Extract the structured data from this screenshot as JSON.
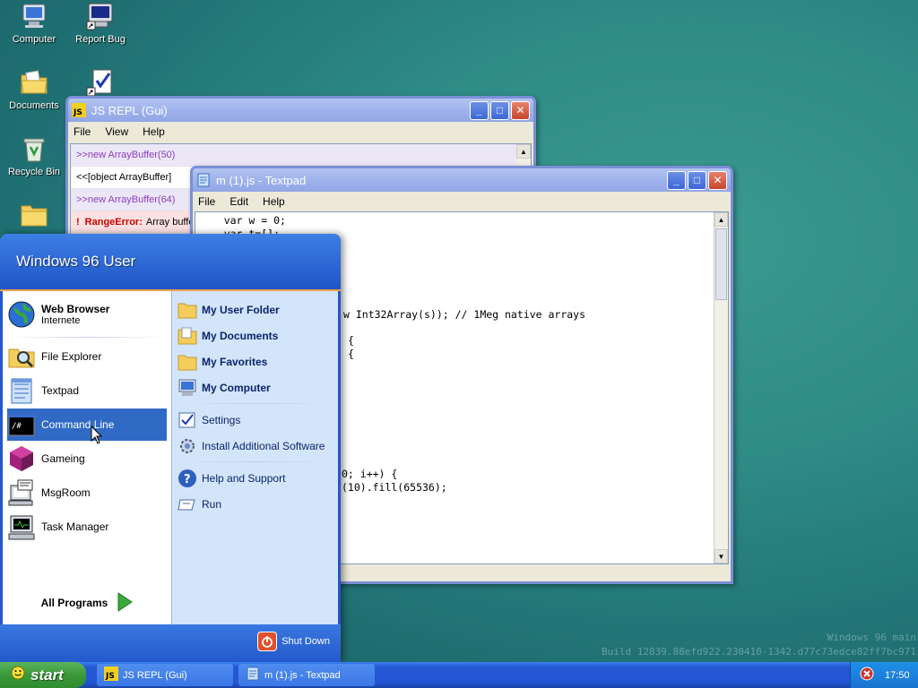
{
  "desktop": {
    "icons": [
      {
        "label": "Computer"
      },
      {
        "label": "Report Bug"
      },
      {
        "label": "Documents"
      },
      {
        "label": ""
      },
      {
        "label": "Recycle Bin"
      },
      {
        "label": ""
      }
    ],
    "watermark_line1": "Windows 96 main",
    "watermark_line2": "Build 12839.88efd922.230410-1342.d77c73edce82ff7bc971"
  },
  "repl_window": {
    "title": "JS REPL (Gui)",
    "menu": [
      "File",
      "View",
      "Help"
    ],
    "lines": [
      {
        "kind": "in",
        "text": ">>new ArrayBuffer(50)"
      },
      {
        "kind": "out",
        "text": "<<[object ArrayBuffer]"
      },
      {
        "kind": "in",
        "text": ">>new ArrayBuffer(64)"
      },
      {
        "kind": "err",
        "prefix": "!",
        "error_name": "RangeError:",
        "text": "Array buffe"
      }
    ]
  },
  "textpad_window": {
    "title": "m (1).js - Textpad",
    "menu": [
      "File",
      "Edit",
      "Help"
    ],
    "code_lines": [
      "    var w = 0;",
      "    var t=[];",
      "w Int32Array(s)); // 1Meg native arrays",
      "{",
      "{",
      "0; i++) {",
      "(10).fill(65536);"
    ]
  },
  "start_menu": {
    "user_name": "Windows 96 User",
    "left_items": [
      {
        "label": "Web Browser",
        "sublabel": "Internete"
      },
      {
        "label": "File Explorer"
      },
      {
        "label": "Textpad"
      },
      {
        "label": "Command Line"
      },
      {
        "label": "Gameing"
      },
      {
        "label": "MsgRoom"
      },
      {
        "label": "Task Manager"
      }
    ],
    "all_programs": "All Programs",
    "right_items": [
      {
        "label": "My User Folder"
      },
      {
        "label": "My Documents"
      },
      {
        "label": "My Favorites"
      },
      {
        "label": "My Computer"
      },
      {
        "label": "Settings"
      },
      {
        "label": "Install Additional Software"
      },
      {
        "label": "Help and Support"
      },
      {
        "label": "Run"
      }
    ],
    "shutdown": "Shut Down"
  },
  "taskbar": {
    "start_label": "start",
    "tasks": [
      {
        "label": "JS REPL (Gui)"
      },
      {
        "label": "m (1).js - Textpad"
      }
    ],
    "clock": "17:50"
  },
  "colors": {
    "accent": "#316ac5",
    "title_bar": "#9fb2ec",
    "start_green": "#3a993a"
  }
}
